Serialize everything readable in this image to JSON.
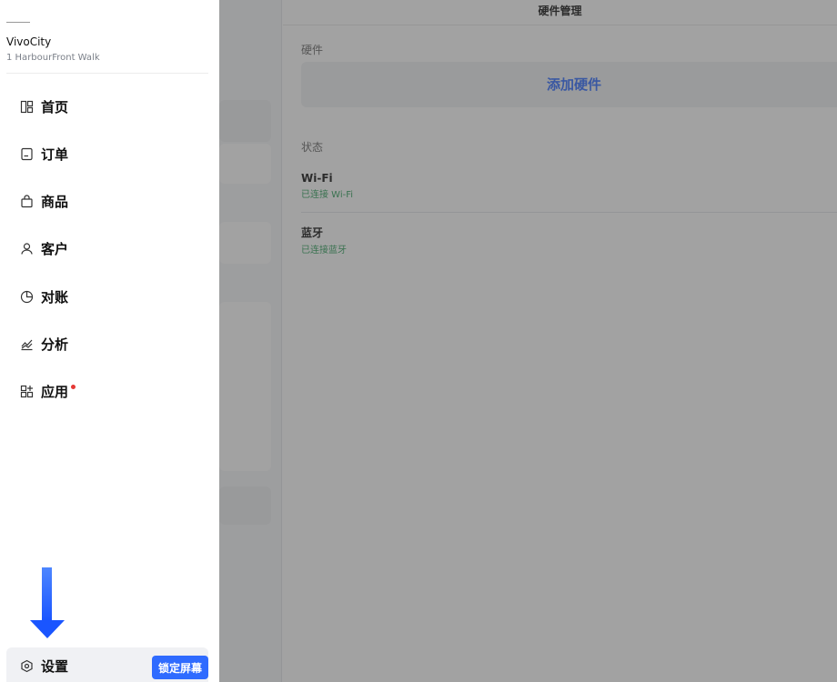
{
  "sidebar": {
    "store": {
      "top_mark": "",
      "name": "VivoCity",
      "address": "1 HarbourFront Walk"
    },
    "items": [
      {
        "label": "首页",
        "icon": "layout-grid-icon"
      },
      {
        "label": "订单",
        "icon": "document-icon"
      },
      {
        "label": "商品",
        "icon": "shopping-bag-icon"
      },
      {
        "label": "客户",
        "icon": "person-icon"
      },
      {
        "label": "对账",
        "icon": "pie-chart-icon"
      },
      {
        "label": "分析",
        "icon": "trend-chart-icon"
      },
      {
        "label": "应用",
        "icon": "apps-grid-icon",
        "badge": true
      }
    ],
    "settings": {
      "label": "设置",
      "icon": "hexagon-settings-icon"
    },
    "lock_screen_label": "锁定屏幕"
  },
  "detail": {
    "title": "硬件管理",
    "hardware_section": "硬件",
    "add_hardware_label": "添加硬件",
    "status_section": "状态",
    "statuses": [
      {
        "name": "Wi-Fi",
        "value": "已连接 Wi-Fi"
      },
      {
        "name": "蓝牙",
        "value": "已连接蓝牙"
      }
    ]
  },
  "colors": {
    "accent": "#2f6bff",
    "connected": "#2e9e5b",
    "badge": "#e53935",
    "arrow": "#1f5cff"
  }
}
